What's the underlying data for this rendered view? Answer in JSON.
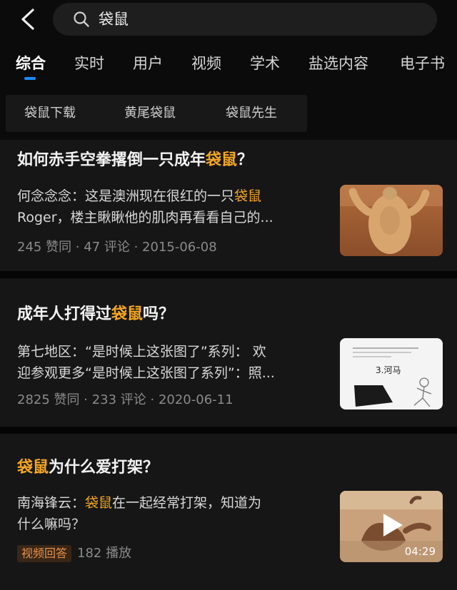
{
  "search": {
    "query": "袋鼠"
  },
  "tabs": [
    "综合",
    "实时",
    "用户",
    "视频",
    "学术",
    "盐选内容",
    "电子书"
  ],
  "chips": [
    "袋鼠下载",
    "黄尾袋鼠",
    "袋鼠先生"
  ],
  "results": [
    {
      "title_pre": "如何赤手空拳撂倒一只成年",
      "title_hl": "袋鼠",
      "title_post": "？",
      "excerpt_line1_pre": "何念念念：这是澳洲现在很红的一只",
      "excerpt_line1_hl": "袋鼠",
      "excerpt_line2": "Roger，楼主瞅瞅他的肌肉再看看自己的...",
      "meta": "245 赞同 · 47 评论 · 2015-06-08",
      "thumb_icon": "muscular-kangaroo-photo"
    },
    {
      "title_pre": "成年人打得过",
      "title_hl": "袋鼠",
      "title_post": "吗？",
      "excerpt_line1": "第七地区：“是时候上这张图了”系列： 欢",
      "excerpt_line2": "迎参观更多“是时候上这张图了系列”：照...",
      "meta": "2825 赞同 · 233 评论 · 2020-06-11",
      "thumb_icon": "meme-comic-image",
      "thumb_text": "3.河马"
    },
    {
      "title_hl": "袋鼠",
      "title_post": "为什么爱打架？",
      "excerpt_line1_pre": "南海锋云：",
      "excerpt_line1_hl": "袋鼠",
      "excerpt_line1_post": "在一起经常打架，知道为",
      "excerpt_line2": "什么嘛吗？",
      "badge": "视频回答",
      "meta": "182 播放",
      "duration": "04:29",
      "thumb_icon": "kangaroo-video-thumbnail"
    }
  ],
  "colors": {
    "highlight": "#f5a623",
    "accent": "#1a8cff",
    "background": "#0b0b0b",
    "card": "#161616"
  }
}
